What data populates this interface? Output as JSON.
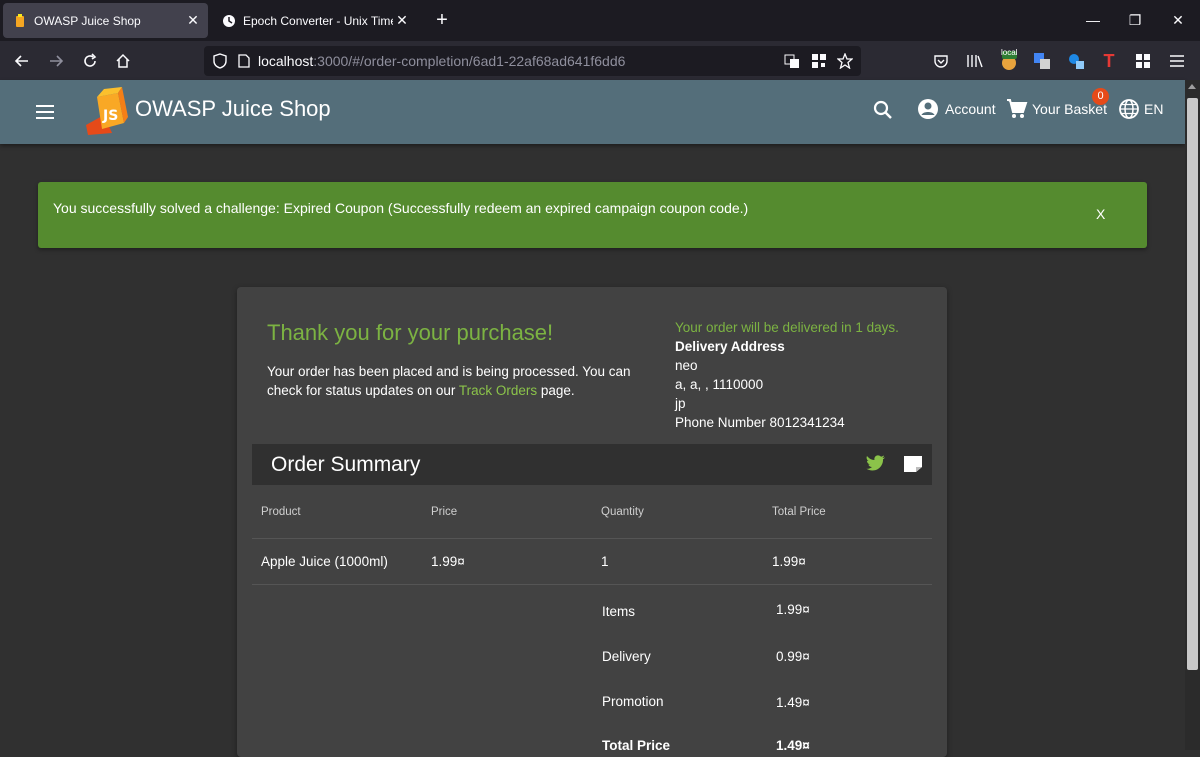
{
  "browser": {
    "tabs": [
      {
        "title": "OWASP Juice Shop",
        "active": true
      },
      {
        "title": "Epoch Converter - Unix Timesta",
        "active": false
      }
    ],
    "url_host": "localhost",
    "url_rest": ":3000/#/order-completion/6ad1-22af68ad641f6dd6",
    "ext_badge": "local"
  },
  "app": {
    "brand": "OWASP Juice Shop",
    "account_label": "Account",
    "basket_label": "Your Basket",
    "basket_count": "0",
    "language": "EN"
  },
  "banner": {
    "message": "You successfully solved a challenge: Expired Coupon (Successfully redeem an expired campaign coupon code.)",
    "close": "X"
  },
  "order": {
    "thanks": "Thank you for your purchase!",
    "placed_text": "Your order has been placed and is being processed. You can check for status updates on our ",
    "track_link": "Track Orders",
    "placed_suffix": " page.",
    "delivery_days": "Your order will be delivered in 1 days.",
    "address_heading": "Delivery Address",
    "address_lines": [
      "neo",
      "a, a, , 1110000",
      "jp",
      "Phone Number 8012341234"
    ]
  },
  "summary": {
    "title": "Order Summary",
    "headers": [
      "Product",
      "Price",
      "Quantity",
      "Total Price"
    ],
    "rows": [
      {
        "product": "Apple Juice (1000ml)",
        "price": "1.99¤",
        "quantity": "1",
        "total": "1.99¤"
      }
    ],
    "totals": [
      {
        "label": "Items",
        "value": "1.99¤"
      },
      {
        "label": "Delivery",
        "value": "0.99¤"
      },
      {
        "label": "Promotion",
        "value": "1.49¤"
      },
      {
        "label": "Total Price",
        "value": "1.49¤"
      }
    ]
  },
  "colors": {
    "toolbar": "#546e7a",
    "success": "#558b2f",
    "accent_green": "#7cb342",
    "badge": "#e64a19"
  }
}
